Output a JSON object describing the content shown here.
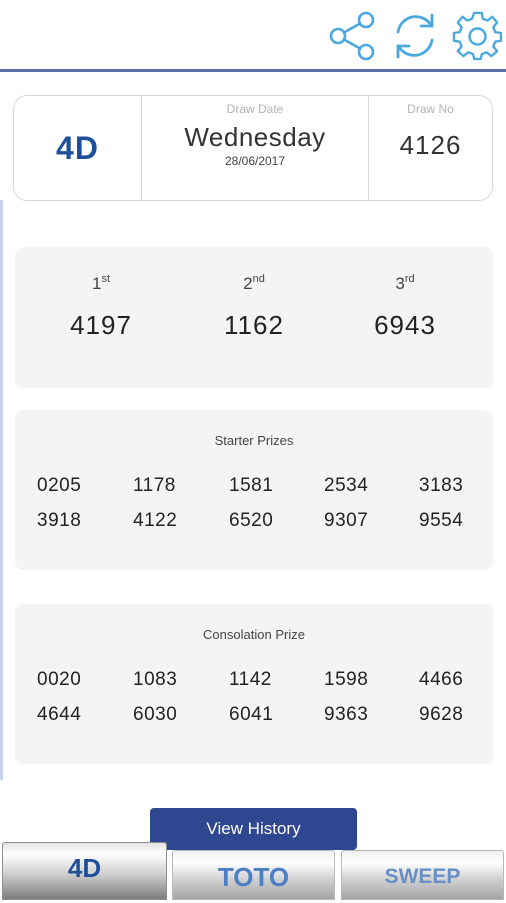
{
  "colors": {
    "accent": "#2f4690",
    "icon": "#4aa8e0",
    "game_title": "#1e4f9a",
    "panel_bg": "#f4f4f4"
  },
  "toolbar": {
    "icons": [
      "share-icon",
      "refresh-icon",
      "settings-gear-icon"
    ]
  },
  "draw": {
    "game": "4D",
    "date_label": "Draw Date",
    "weekday": "Wednesday",
    "date": "28/06/2017",
    "no_label": "Draw No",
    "number": "4126"
  },
  "top_prizes": [
    {
      "place": "1",
      "suffix": "st",
      "number": "4197"
    },
    {
      "place": "2",
      "suffix": "nd",
      "number": "1162"
    },
    {
      "place": "3",
      "suffix": "rd",
      "number": "6943"
    }
  ],
  "starter": {
    "title": "Starter Prizes",
    "numbers": [
      "0205",
      "1178",
      "1581",
      "2534",
      "3183",
      "3918",
      "4122",
      "6520",
      "9307",
      "9554"
    ]
  },
  "consolation": {
    "title": "Consolation Prize",
    "numbers": [
      "0020",
      "1083",
      "1142",
      "1598",
      "4466",
      "4644",
      "6030",
      "6041",
      "9363",
      "9628"
    ]
  },
  "history_button": "View History",
  "tabs": [
    {
      "label": "4D",
      "active": true
    },
    {
      "label": "TOTO",
      "active": false
    },
    {
      "label": "SWEEP",
      "active": false
    }
  ]
}
